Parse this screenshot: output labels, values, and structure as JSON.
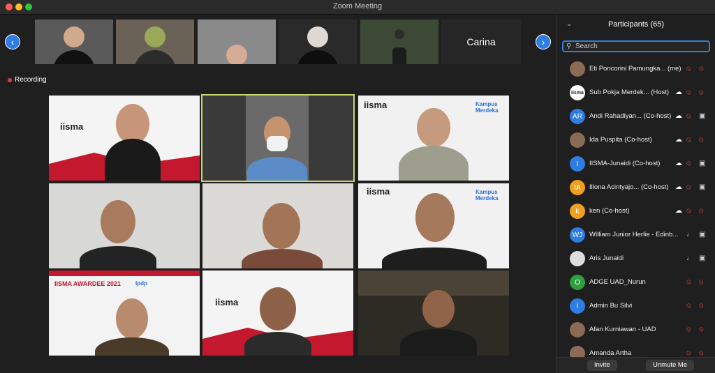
{
  "window": {
    "title": "Zoom Meeting"
  },
  "recording": {
    "label": "Recording"
  },
  "strip": {
    "name_tile": "Carina"
  },
  "slides": {
    "brand": "iisma",
    "kampus": "Kampus Merdeka",
    "awardee": "IISMA AWARDEE 2021",
    "lpdp": "lpdp"
  },
  "panel": {
    "title": "Participants (65)",
    "search_placeholder": "Search",
    "invite_label": "Invite",
    "unmute_label": "Unmute Me",
    "participants": [
      {
        "name": "Eti Poncorini Pamungka...",
        "role": "(me)",
        "avatar": "",
        "avatar_color": "#8b6b55",
        "mic_muted": true,
        "cam_off": true,
        "cloud": false
      },
      {
        "name": "Sub Pokja Merdek...",
        "role": "(Host)",
        "avatar": "iisma",
        "avatar_color": "#ffffff",
        "mic_muted": true,
        "cam_off": true,
        "cloud": true
      },
      {
        "name": "Andi Rahadiyan...",
        "role": "(Co-host)",
        "avatar": "AR",
        "avatar_color": "#2f7de1",
        "mic_muted": true,
        "cam_off": false,
        "cloud": true
      },
      {
        "name": "Ida Puspita",
        "role": "(Co-host)",
        "avatar": "",
        "avatar_color": "#8b6b55",
        "mic_muted": true,
        "cam_off": true,
        "cloud": true
      },
      {
        "name": "IISMA-Junaidi",
        "role": "(Co-host)",
        "avatar": "I",
        "avatar_color": "#2f7de1",
        "mic_muted": true,
        "cam_off": false,
        "cloud": true
      },
      {
        "name": "Illona Acintyajo...",
        "role": "(Co-host)",
        "avatar": "IA",
        "avatar_color": "#f0a020",
        "mic_muted": true,
        "cam_off": false,
        "cloud": true
      },
      {
        "name": "ken",
        "role": "(Co-host)",
        "avatar": "k",
        "avatar_color": "#f0a020",
        "mic_muted": true,
        "cam_off": true,
        "cloud": true
      },
      {
        "name": "William Junior Herlie - Edinb...",
        "role": "",
        "avatar": "WJ",
        "avatar_color": "#2f7de1",
        "mic_muted": false,
        "cam_off": false,
        "cloud": false
      },
      {
        "name": "Aris Junaidi",
        "role": "",
        "avatar": "",
        "avatar_color": "#dddddd",
        "mic_muted": false,
        "cam_off": false,
        "cloud": false
      },
      {
        "name": "ADGE UAD_Nurun",
        "role": "",
        "avatar": "O",
        "avatar_color": "#2e9e3e",
        "mic_muted": true,
        "cam_off": true,
        "cloud": false
      },
      {
        "name": "Admin Bu Silvi",
        "role": "",
        "avatar": "I",
        "avatar_color": "#2f7de1",
        "mic_muted": true,
        "cam_off": true,
        "cloud": false
      },
      {
        "name": "Afan Kurniawan - UAD",
        "role": "",
        "avatar": "",
        "avatar_color": "#8b6b55",
        "mic_muted": true,
        "cam_off": true,
        "cloud": false
      },
      {
        "name": "Amanda Artha",
        "role": "",
        "avatar": "",
        "avatar_color": "#8b6b55",
        "mic_muted": true,
        "cam_off": true,
        "cloud": false
      }
    ]
  }
}
